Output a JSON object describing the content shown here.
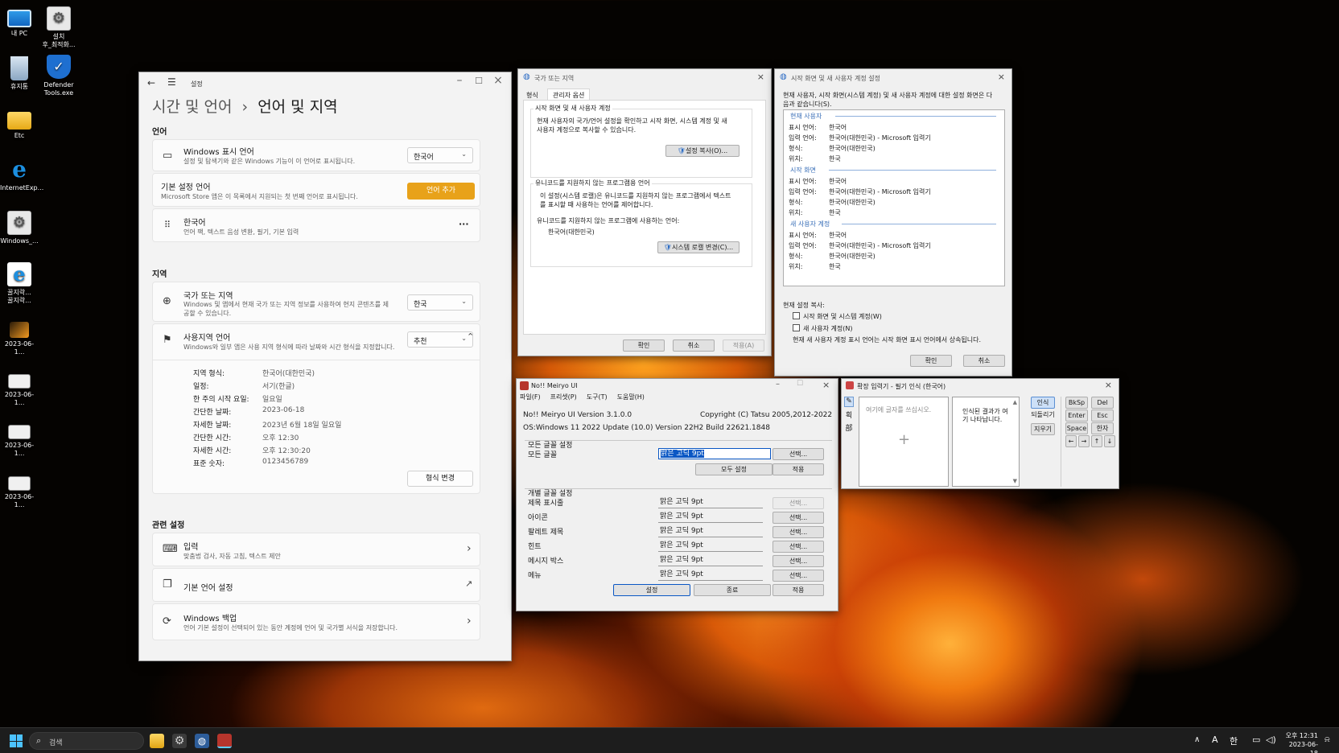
{
  "desktop": {
    "icons": [
      {
        "label": "내 PC",
        "icon": "monitor-icon"
      },
      {
        "label": "설치\n후_최적화...",
        "icon": "gear-file-icon"
      },
      {
        "label": "휴지통",
        "icon": "recycle-bin-icon"
      },
      {
        "label": "Defender\nTools.exe",
        "icon": "shield-icon"
      },
      {
        "label": "Etc",
        "icon": "folder-icon"
      },
      {
        "label": "InternetExp...",
        "icon": "internet-explorer-icon"
      },
      {
        "label": "Windows_...",
        "icon": "gear-file-icon"
      },
      {
        "label": "꿀지락...\n꿀지락...",
        "icon": "internet-explorer-icon"
      },
      {
        "label": "2023-06-1...",
        "icon": "image-icon"
      },
      {
        "label": "2023-06-1...",
        "icon": "image-icon"
      },
      {
        "label": "2023-06-1...",
        "icon": "image-icon"
      },
      {
        "label": "2023-06-1...",
        "icon": "image-icon"
      }
    ]
  },
  "settings": {
    "title": "설정",
    "breadcrumb_parent": "시간 및 언어",
    "breadcrumb_sep": "›",
    "breadcrumb_current": "언어 및 지역",
    "section_language": "언어",
    "display_lang": {
      "title": "Windows 표시 언어",
      "sub": "설정 및 탐색기와 같은 Windows 기능이 이 언어로 표시됩니다.",
      "value": "한국어"
    },
    "preferred": {
      "title": "기본 설정 언어",
      "sub": "Microsoft Store 앱은 이 목록에서 지원되는 첫 번째 언어로 표시됩니다.",
      "button": "언어 추가"
    },
    "korean": {
      "title": "한국어",
      "sub": "언어 팩, 텍스트 음성 변환, 필기, 기본 입력",
      "more": "···"
    },
    "section_region": "지역",
    "country": {
      "title": "국가 또는 지역",
      "sub": "Windows 및 앱에서 현재 국가 또는 지역 정보를 사용하여 현지 콘텐츠를 제",
      "sub2": "공할 수 있습니다.",
      "value": "한국"
    },
    "regional_format": {
      "title": "사용지역 언어",
      "sub": "Windows와 일부 앱은 사용 지역 형식에 따라 날짜와 시간 형식을 지정합니다.",
      "value": "추천"
    },
    "format_rows": [
      {
        "k": "지역 형식:",
        "v": "한국어(대한민국)"
      },
      {
        "k": "일정:",
        "v": "서기(한글)"
      },
      {
        "k": "한 주의 시작 요일:",
        "v": "일요일"
      },
      {
        "k": "간단한 날짜:",
        "v": "2023-06-18"
      },
      {
        "k": "자세한 날짜:",
        "v": "2023년 6월 18일 일요일"
      },
      {
        "k": "간단한 시간:",
        "v": "오후 12:30"
      },
      {
        "k": "자세한 시간:",
        "v": "오후 12:30:20"
      },
      {
        "k": "표준 숫자:",
        "v": "0123456789"
      }
    ],
    "change_format": "형식 변경",
    "section_related": "관련 설정",
    "typing": {
      "title": "입력",
      "sub": "맞춤법 검사, 자동 고침, 텍스트 제안"
    },
    "admin_lang": {
      "title": "기본 언어 설정"
    },
    "backup": {
      "title": "Windows 백업",
      "sub": "언어 기본 설정이 선택되어 있는 동안 계정에 언어 및 국가별 서식을 저장합니다."
    }
  },
  "region_dialog": {
    "title": "국가 또는 지역",
    "tabs": [
      "형식",
      "관리자 옵션"
    ],
    "group1_label": "시작 화면 및 새 사용자 계정",
    "group1_text1": "현재 사용자의 국가/언어 설정을 확인하고 시작 화면, 시스템 계정 및 새",
    "group1_text2": "사용자 계정으로 복사할 수 있습니다.",
    "copy_button": "설정 복사(O)...",
    "group2_label": "유니코드를 지원하지 않는 프로그램용 언어",
    "group2_text1": "이 설정(시스템 로캘)은 유니코드를 지원하지 않는 프로그램에서 텍스트",
    "group2_text2": "를 표시할 때 사용하는 언어를 제어합니다.",
    "group2_text3": "유니코드를 지원하지 않는 프로그램에 사용하는 언어:",
    "current_locale": "한국어(대한민국)",
    "locale_button": "시스템 로캘 변경(C)...",
    "ok": "확인",
    "cancel": "취소",
    "apply": "적용(A)"
  },
  "copy_dialog": {
    "title": "시작 화면 및 새 사용자 계정 설정",
    "intro1": "현재 사용자, 시작 화면(시스템 계정) 및 새 사용자 계정에 대한 설정 화면은 다",
    "intro2": "음과 같습니다(S).",
    "groups": [
      {
        "name": "현재 사용자",
        "rows": [
          {
            "k": "표시 언어:",
            "v": "한국어"
          },
          {
            "k": "입력 언어:",
            "v": "한국어(대한민국) - Microsoft 입력기"
          },
          {
            "k": "형식:",
            "v": "한국어(대한민국)"
          },
          {
            "k": "위치:",
            "v": "한국"
          }
        ]
      },
      {
        "name": "시작 화면",
        "rows": [
          {
            "k": "표시 언어:",
            "v": "한국어"
          },
          {
            "k": "입력 언어:",
            "v": "한국어(대한민국) - Microsoft 입력기"
          },
          {
            "k": "형식:",
            "v": "한국어(대한민국)"
          },
          {
            "k": "위치:",
            "v": "한국"
          }
        ]
      },
      {
        "name": "새 사용자 계정",
        "rows": [
          {
            "k": "표시 언어:",
            "v": "한국어"
          },
          {
            "k": "입력 언어:",
            "v": "한국어(대한민국) - Microsoft 입력기"
          },
          {
            "k": "형식:",
            "v": "한국어(대한민국)"
          },
          {
            "k": "위치:",
            "v": "한국"
          }
        ]
      }
    ],
    "copy_label": "현재 설정 복사:",
    "check1": "시작 화면 및 시스템 계정(W)",
    "check2": "새 사용자 계정(N)",
    "note": "현재 새 사용자 계정 표시 언어는 시작 화면 표시 언어에서 상속됩니다.",
    "ok": "확인",
    "cancel": "취소"
  },
  "meiryo": {
    "title": "No!! Meiryo UI",
    "menu": [
      "파일(F)",
      "프리셋(P)",
      "도구(T)",
      "도움말(H)"
    ],
    "version": "No!! Meiryo UI Version 3.1.0.0",
    "copyright": "Copyright (C) Tatsu 2005,2012-2022",
    "os": "OS:Windows 11 2022 Update (10.0) Version 22H2 Build 22621.1848",
    "all_group": "모든 글꼴 설정",
    "all_label": "모든 글꼴",
    "all_font": "맑은 고딕   9pt",
    "select": "선택...",
    "set_all": "모두 설정",
    "apply": "적용",
    "indiv_group": "개별 글꼴 설정",
    "rows": [
      {
        "label": "제목 표시줄",
        "font": "맑은 고딕   9pt"
      },
      {
        "label": "아이콘",
        "font": "맑은 고딕   9pt"
      },
      {
        "label": "팔레트 제목",
        "font": "맑은 고딕   9pt"
      },
      {
        "label": "힌트",
        "font": "맑은 고딕   9pt"
      },
      {
        "label": "메시지 박스",
        "font": "맑은 고딕   9pt"
      },
      {
        "label": "메뉴",
        "font": "맑은 고딕   9pt"
      }
    ],
    "btn_set": "설정",
    "btn_exit": "종료",
    "btn_apply": "적용"
  },
  "ime_pad": {
    "title": "확장 입력기 - 필기 인식 (한국어)",
    "placeholder": "여기에 글자를 쓰십시오.",
    "result_text1": "인식된 결과가 여",
    "result_text2": "기 나타납니다.",
    "buttons": [
      "인식",
      "되돌리기",
      "지우기"
    ],
    "keys": [
      "BkSp",
      "Del",
      "Enter",
      "Esc",
      "Space",
      "한자"
    ],
    "arrows": [
      "←",
      "→",
      "↑",
      "↓"
    ],
    "side": [
      "✎",
      "획",
      "部"
    ]
  },
  "taskbar": {
    "search_placeholder": "검색",
    "tray": [
      "∧",
      "A",
      "한"
    ],
    "time": "오후 12:31",
    "date": "2023-06-18"
  },
  "colors": {
    "accent": "#e8a21a",
    "highlight": "#0a57c4",
    "taskbar": "#1d1d1d"
  }
}
